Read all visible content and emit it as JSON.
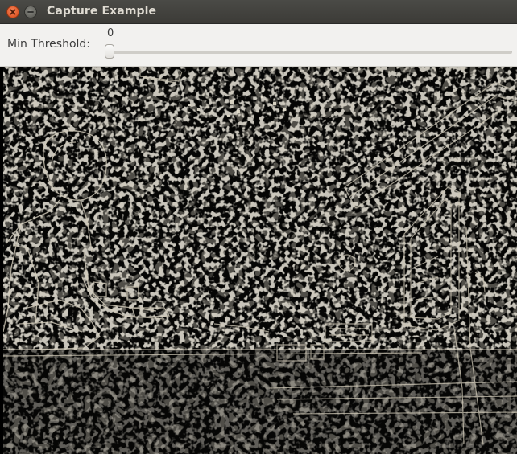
{
  "window": {
    "title": "Capture Example"
  },
  "trackbar": {
    "label": "Min Threshold:",
    "value": "0",
    "position": 0
  },
  "colors": {
    "titlebar": "#3c3b37",
    "close_button": "#e25a2a",
    "toolbar_bg": "#f2f1ef",
    "edge_light": "#d8d2c2",
    "edge_mid": "#8a8474"
  },
  "icons": {
    "close": "close-icon",
    "minimize": "minimize-icon"
  }
}
